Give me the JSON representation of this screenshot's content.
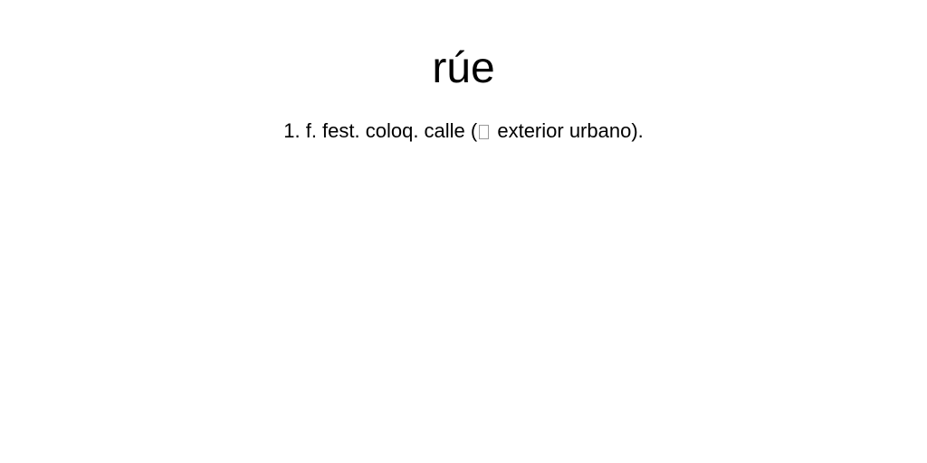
{
  "entry": {
    "headword": "rúe",
    "definition": {
      "number": "1.",
      "text_before": "f. fest. coloq. calle (",
      "missing_glyph": "placeholder-box",
      "text_after": " exterior urbano)."
    }
  }
}
